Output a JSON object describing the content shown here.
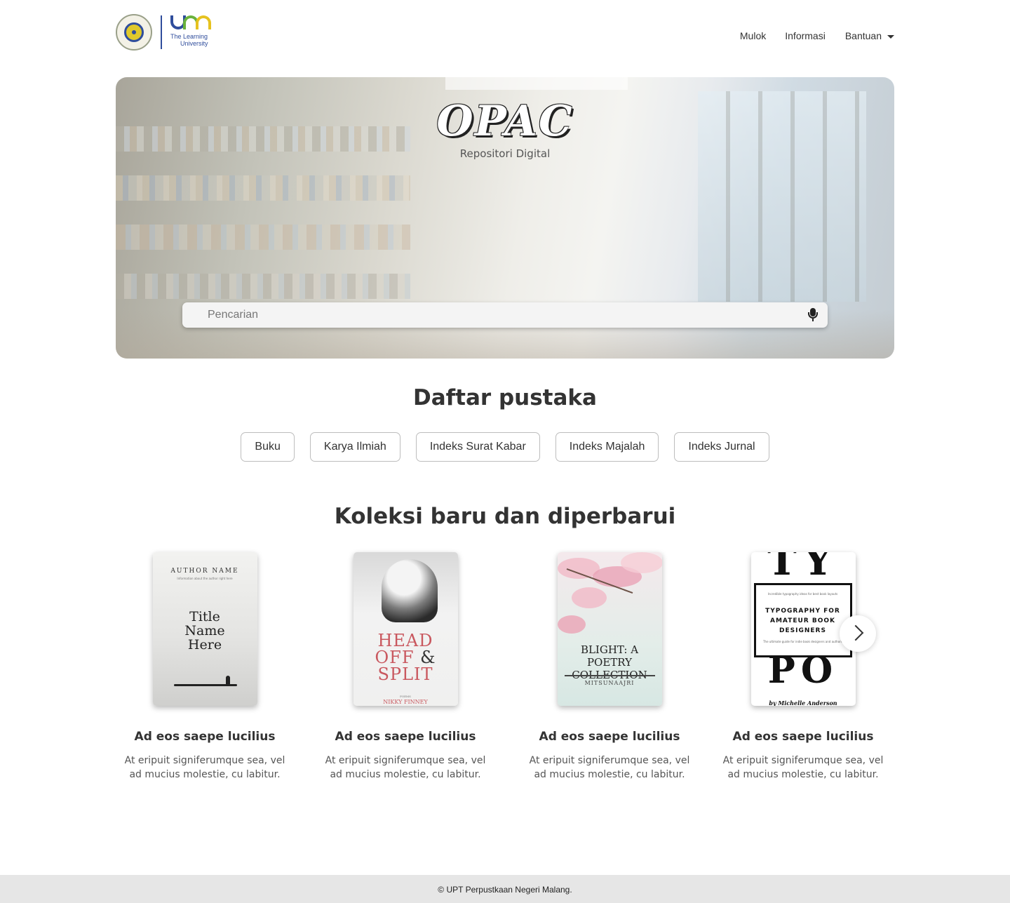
{
  "header": {
    "logo_tagline_line1": "The Learning",
    "logo_tagline_line2": "University",
    "nav": {
      "item1": "Mulok",
      "item2": "Informasi",
      "item3": "Bantuan"
    }
  },
  "hero": {
    "title": "OPAC",
    "subtitle": "Repositori Digital",
    "search_placeholder": "Pencarian"
  },
  "catalog": {
    "title": "Daftar pustaka",
    "categories": [
      "Buku",
      "Karya Ilmiah",
      "Indeks Surat Kabar",
      "Indeks Majalah",
      "Indeks Jurnal"
    ]
  },
  "collection": {
    "title": "Koleksi baru dan diperbarui",
    "books": [
      {
        "title": "Ad eos saepe lucilius",
        "description": "At eripuit signiferumque sea, vel ad mucius molestie, cu labitur.",
        "cover": {
          "author": "AUTHOR NAME",
          "tagline": "Information about the author right here",
          "line1": "Title",
          "line2": "Name",
          "line3": "Here"
        }
      },
      {
        "title": "Ad eos saepe lucilius",
        "description": "At eripuit signiferumque sea, vel ad mucius molestie, cu labitur.",
        "cover": {
          "line1": "HEAD",
          "line2": "OFF",
          "amp": "&",
          "line3": "SPLIT",
          "poems": "POEMS",
          "author": "NIKKY FINNEY"
        }
      },
      {
        "title": "Ad eos saepe lucilius",
        "description": "At eripuit signiferumque sea, vel ad mucius molestie, cu labitur.",
        "cover": {
          "line1": "BLIGHT: A POETRY",
          "line2": "COLLECTION",
          "author": "MITSUNAAJRI"
        }
      },
      {
        "title": "Ad eos saepe lucilius",
        "description": "At eripuit signiferumque sea, vel ad mucius molestie, cu labitur.",
        "cover": {
          "top": "TY",
          "bottom": "PO",
          "small_top": "Incredible typography ideas for best book layouts",
          "heading1": "TYPOGRAPHY FOR",
          "heading2": "AMATEUR BOOK",
          "heading3": "DESIGNERS",
          "small_bottom": "The ultimate guide for indie book designers and authors",
          "author": "by Michelle Anderson"
        }
      }
    ]
  },
  "footer": {
    "text": "© UPT Perpustkaan Negeri Malang."
  },
  "icons": {
    "mic": "microphone-icon",
    "next": "chevron-right-icon",
    "dropdown": "caret-down-icon"
  },
  "colors": {
    "brand_blue": "#2f4d9c",
    "brand_green": "#6ab23d",
    "brand_yellow": "#e6c21f",
    "footer_bg": "#e6e6e6"
  }
}
